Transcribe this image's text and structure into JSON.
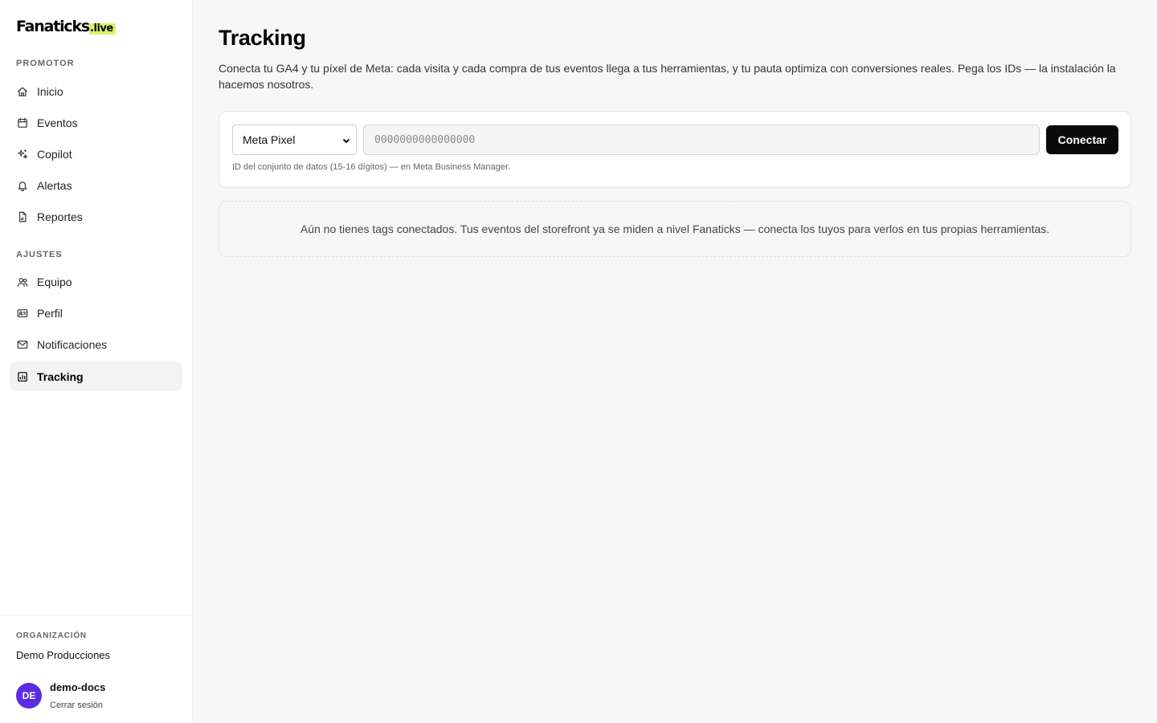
{
  "brand": {
    "name": "Fanaticks",
    "suffix": ".live",
    "accent": "#d6f36b"
  },
  "sidebar": {
    "section_promotor": "PROMOTOR",
    "section_ajustes": "AJUSTES",
    "items": [
      {
        "label": "Inicio",
        "icon": "home-icon"
      },
      {
        "label": "Eventos",
        "icon": "calendar-icon"
      },
      {
        "label": "Copilot",
        "icon": "sparkles-icon"
      },
      {
        "label": "Alertas",
        "icon": "bell-icon"
      },
      {
        "label": "Reportes",
        "icon": "report-icon"
      },
      {
        "label": "Equipo",
        "icon": "users-icon"
      },
      {
        "label": "Perfil",
        "icon": "id-card-icon"
      },
      {
        "label": "Notificaciones",
        "icon": "mail-icon"
      },
      {
        "label": "Tracking",
        "icon": "chart-icon",
        "active": true
      }
    ],
    "org_label": "ORGANIZACIÓN",
    "org_name": "Demo Producciones",
    "user": {
      "initials": "DE",
      "name": "demo-docs",
      "logout": "Cerrar sesión",
      "avatar_color": "#5b2be0"
    }
  },
  "main": {
    "title": "Tracking",
    "description": "Conecta tu GA4 y tu píxel de Meta: cada visita y cada compra de tus eventos llega a tus herramientas, y tu pauta optimiza con conversiones reales. Pega los IDs — la instalación la hacemos nosotros.",
    "form": {
      "select_value": "Meta Pixel",
      "input_placeholder": "0000000000000000",
      "input_value": "",
      "button_label": "Conectar",
      "hint": "ID del conjunto de datos (15-16 dígitos) — en Meta Business Manager."
    },
    "empty_state": "Aún no tienes tags conectados. Tus eventos del storefront ya se miden a nivel Fanaticks — conecta los tuyos para verlos en tus propias herramientas."
  }
}
